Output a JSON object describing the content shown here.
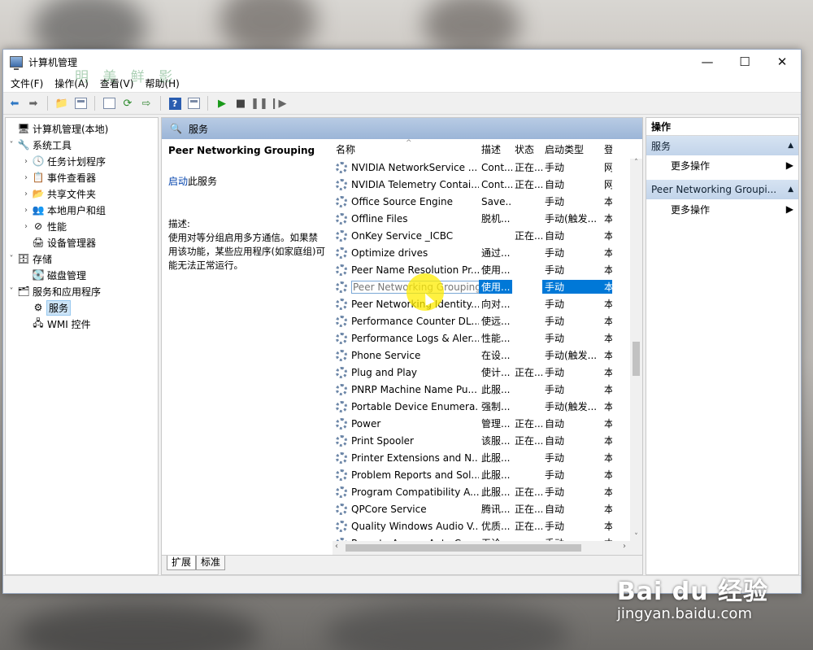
{
  "window": {
    "title": "计算机管理",
    "controls": {
      "minimize": "—",
      "maximize": "☐",
      "close": "✕"
    }
  },
  "menu": [
    "文件(F)",
    "操作(A)",
    "查看(V)",
    "帮助(H)"
  ],
  "overlay_text": "明 美 鲜 影",
  "tree": {
    "root": "计算机管理(本地)",
    "system_tools": "系统工具",
    "task_scheduler": "任务计划程序",
    "event_viewer": "事件查看器",
    "shared_folders": "共享文件夹",
    "local_users": "本地用户和组",
    "performance": "性能",
    "device_manager": "设备管理器",
    "storage": "存储",
    "disk_management": "磁盘管理",
    "services_apps": "服务和应用程序",
    "services": "服务",
    "wmi": "WMI 控件"
  },
  "center": {
    "header": "服务",
    "detail_title": "Peer Networking Grouping",
    "detail_link": "启动",
    "detail_link_suffix": "此服务",
    "desc_label": "描述:",
    "desc_text": "使用对等分组启用多方通信。如果禁用该功能，某些应用程序(如家庭组)可能无法正常运行。",
    "columns": {
      "name": "名称",
      "desc": "描述",
      "status": "状态",
      "startup": "启动类型",
      "logon": "登"
    },
    "rows": [
      {
        "name": "NVIDIA NetworkService ...",
        "desc": "Cont...",
        "status": "正在...",
        "startup": "手动",
        "logon": "网"
      },
      {
        "name": "NVIDIA Telemetry Contai...",
        "desc": "Cont...",
        "status": "正在...",
        "startup": "自动",
        "logon": "网"
      },
      {
        "name": "Office  Source Engine",
        "desc": "Save...",
        "status": "",
        "startup": "手动",
        "logon": "本"
      },
      {
        "name": "Offline Files",
        "desc": "脱机...",
        "status": "",
        "startup": "手动(触发...",
        "logon": "本"
      },
      {
        "name": "OnKey Service _ICBC",
        "desc": "",
        "status": "正在...",
        "startup": "自动",
        "logon": "本"
      },
      {
        "name": "Optimize drives",
        "desc": "通过...",
        "status": "",
        "startup": "手动",
        "logon": "本"
      },
      {
        "name": "Peer Name Resolution Pr...",
        "desc": "使用...",
        "status": "",
        "startup": "手动",
        "logon": "本"
      },
      {
        "name": "Peer Networking Grouping",
        "desc": "使用...",
        "status": "",
        "startup": "手动",
        "logon": "本"
      },
      {
        "name": "Peer Networking Identity...",
        "desc": "向对...",
        "status": "",
        "startup": "手动",
        "logon": "本"
      },
      {
        "name": "Performance Counter DL...",
        "desc": "使远...",
        "status": "",
        "startup": "手动",
        "logon": "本"
      },
      {
        "name": "Performance Logs & Aler...",
        "desc": "性能...",
        "status": "",
        "startup": "手动",
        "logon": "本"
      },
      {
        "name": "Phone Service",
        "desc": "在设...",
        "status": "",
        "startup": "手动(触发...",
        "logon": "本"
      },
      {
        "name": "Plug and Play",
        "desc": "使计...",
        "status": "正在...",
        "startup": "手动",
        "logon": "本"
      },
      {
        "name": "PNRP Machine Name Pu...",
        "desc": "此服...",
        "status": "",
        "startup": "手动",
        "logon": "本"
      },
      {
        "name": "Portable Device Enumera...",
        "desc": "强制...",
        "status": "",
        "startup": "手动(触发...",
        "logon": "本"
      },
      {
        "name": "Power",
        "desc": "管理...",
        "status": "正在...",
        "startup": "自动",
        "logon": "本"
      },
      {
        "name": "Print Spooler",
        "desc": "该服...",
        "status": "正在...",
        "startup": "自动",
        "logon": "本"
      },
      {
        "name": "Printer Extensions and N...",
        "desc": "此服...",
        "status": "",
        "startup": "手动",
        "logon": "本"
      },
      {
        "name": "Problem Reports and Sol...",
        "desc": "此服...",
        "status": "",
        "startup": "手动",
        "logon": "本"
      },
      {
        "name": "Program Compatibility A...",
        "desc": "此服...",
        "status": "正在...",
        "startup": "手动",
        "logon": "本"
      },
      {
        "name": "QPCore Service",
        "desc": "腾讯...",
        "status": "正在...",
        "startup": "自动",
        "logon": "本"
      },
      {
        "name": "Quality Windows Audio V...",
        "desc": "优质...",
        "status": "正在...",
        "startup": "手动",
        "logon": "本"
      },
      {
        "name": "Remote Access Auto C...",
        "desc": "无论...",
        "status": "",
        "startup": "手动",
        "logon": "本"
      }
    ],
    "selected_row": 7,
    "tabs": [
      "扩展",
      "标准"
    ]
  },
  "actions": {
    "header": "操作",
    "section1": "服务",
    "section1_item": "更多操作",
    "section2": "Peer Networking Groupi...",
    "section2_item": "更多操作"
  },
  "watermark": {
    "brand": "Bai du 经验",
    "url": "jingyan.baidu.com"
  },
  "colors": {
    "selection": "#0078d7",
    "header_band": "#9bb5d7",
    "section_band": "#c2d4ea",
    "link": "#0645ad"
  }
}
